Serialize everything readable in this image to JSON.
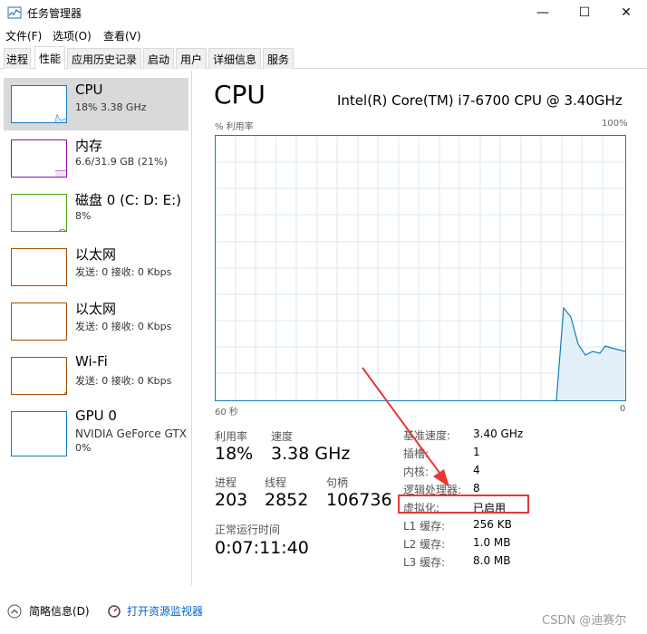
{
  "window": {
    "title": "任务管理器",
    "min_icon": "minimize-icon",
    "max_icon": "maximize-icon",
    "close_icon": "close-icon"
  },
  "menu": [
    "文件(F)",
    "选项(O)",
    "查看(V)"
  ],
  "tabs": [
    "进程",
    "性能",
    "应用历史记录",
    "启动",
    "用户",
    "详细信息",
    "服务"
  ],
  "active_tab": "性能",
  "resources": [
    {
      "name": "CPU",
      "sub": "18% 3.38 GHz",
      "color": "#117dbb",
      "selected": true
    },
    {
      "name": "内存",
      "sub": "6.6/31.9 GB (21%)",
      "color": "#8b12ae"
    },
    {
      "name": "磁盘 0 (C: D: E:)",
      "sub": "8%",
      "color": "#4da60c"
    },
    {
      "name": "以太网",
      "sub": "发送: 0 接收: 0 Kbps",
      "color": "#a74f01"
    },
    {
      "name": "以太网",
      "sub": "发送: 0 接收: 0 Kbps",
      "color": "#a74f01"
    },
    {
      "name": "Wi-Fi",
      "sub": "发送: 0 接收: 0 Kbps",
      "color": "#a74f01"
    },
    {
      "name": "GPU 0",
      "sub_line1": "NVIDIA GeForce GTX",
      "sub_line2": "0%",
      "color": "#117dbb"
    }
  ],
  "main": {
    "title": "CPU",
    "model": "Intel(R) Core(TM) i7-6700 CPU @ 3.40GHz",
    "graph_label_tl": "% 利用率",
    "graph_label_tr": "100%",
    "graph_label_bl": "60 秒",
    "graph_label_br": "0"
  },
  "stats": {
    "util_label": "利用率",
    "util_value": "18%",
    "speed_label": "速度",
    "speed_value": "3.38 GHz",
    "proc_label": "进程",
    "proc_value": "203",
    "thread_label": "线程",
    "thread_value": "2852",
    "handle_label": "句柄",
    "handle_value": "106736",
    "uptime_label": "正常运行时间",
    "uptime_value": "0:07:11:40"
  },
  "info": [
    {
      "label": "基准速度:",
      "value": "3.40 GHz"
    },
    {
      "label": "插槽:",
      "value": "1"
    },
    {
      "label": "内核:",
      "value": "4"
    },
    {
      "label": "逻辑处理器:",
      "value": "8"
    },
    {
      "label": "虚拟化:",
      "value": "已启用"
    },
    {
      "label": "L1 缓存:",
      "value": "256 KB"
    },
    {
      "label": "L2 缓存:",
      "value": "1.0 MB"
    },
    {
      "label": "L3 缓存:",
      "value": "8.0 MB"
    }
  ],
  "footer": {
    "summary": "简略信息(D)",
    "monitor": "打开资源监视器"
  },
  "watermark": "CSDN @迪赛尔",
  "colors": {
    "cpu_line": "#117dbb",
    "annotation": "#e53935"
  }
}
